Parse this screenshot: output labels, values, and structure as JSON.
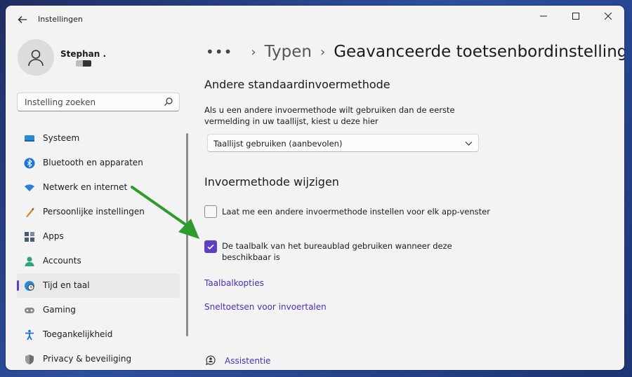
{
  "window": {
    "title": "Instellingen"
  },
  "user": {
    "name": "Stephan ."
  },
  "search": {
    "placeholder": "Instelling zoeken"
  },
  "sidebar": {
    "items": [
      {
        "label": "Systeem",
        "icon": "monitor-icon"
      },
      {
        "label": "Bluetooth en apparaten",
        "icon": "bluetooth-icon"
      },
      {
        "label": "Netwerk en internet",
        "icon": "wifi-icon"
      },
      {
        "label": "Persoonlijke instellingen",
        "icon": "brush-icon"
      },
      {
        "label": "Apps",
        "icon": "apps-icon"
      },
      {
        "label": "Accounts",
        "icon": "person-icon"
      },
      {
        "label": "Tijd en taal",
        "icon": "globe-clock-icon",
        "active": true
      },
      {
        "label": "Gaming",
        "icon": "gamepad-icon"
      },
      {
        "label": "Toegankelijkheid",
        "icon": "accessibility-icon"
      },
      {
        "label": "Privacy & beveiliging",
        "icon": "shield-icon"
      }
    ]
  },
  "breadcrumb": {
    "more": "•••",
    "parent": "Typen",
    "current": "Geavanceerde toetsenbordinstellingen"
  },
  "section1": {
    "title": "Andere standaardinvoermethode",
    "description": "Als u een andere invoermethode wilt gebruiken dan de eerste vermelding in uw taallijst, kiest u deze hier",
    "dropdown_value": "Taallijst gebruiken (aanbevolen)"
  },
  "section2": {
    "title": "Invoermethode wijzigen",
    "checkbox1": {
      "label": "Laat me een andere invoermethode instellen voor elk app-venster",
      "checked": false
    },
    "checkbox2": {
      "label": "De taalbalk van het bureaublad gebruiken wanneer deze beschikbaar is",
      "checked": true
    },
    "link1": "Taalbalkopties",
    "link2": "Sneltoetsen voor invoertalen"
  },
  "help": {
    "label": "Assistentie"
  },
  "colors": {
    "accent": "#5f3ec3",
    "link": "#4a2fb8",
    "annotation_arrow": "#2e9b2e"
  }
}
